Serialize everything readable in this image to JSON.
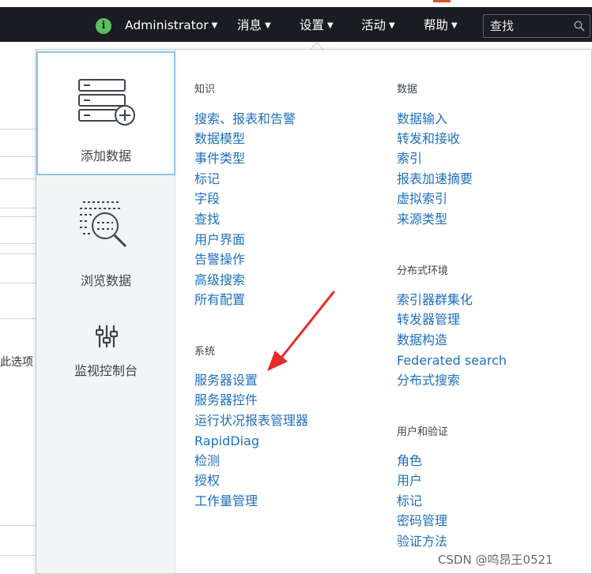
{
  "topbar": {
    "user_name": "Administrator",
    "menu_messages": "消息",
    "menu_settings": "设置",
    "menu_activity": "活动",
    "menu_help": "帮助",
    "search_placeholder": "查找"
  },
  "background": {
    "partial_text": "此选项"
  },
  "dropdown": {
    "tiles": [
      {
        "label": "添加数据",
        "icon": "add-data-icon"
      },
      {
        "label": "浏览数据",
        "icon": "explore-data-icon"
      },
      {
        "label": "监视控制台",
        "icon": "monitoring-console-icon"
      }
    ],
    "knowledge": {
      "title": "知识",
      "items": [
        "搜索、报表和告警",
        "数据模型",
        "事件类型",
        "标记",
        "字段",
        "查找",
        "用户界面",
        "告警操作",
        "高级搜索",
        "所有配置"
      ]
    },
    "system": {
      "title": "系统",
      "items": [
        "服务器设置",
        "服务器控件",
        "运行状况报表管理器",
        "RapidDiag",
        "检测",
        "授权",
        "工作量管理"
      ]
    },
    "data": {
      "title": "数据",
      "items": [
        "数据输入",
        "转发和接收",
        "索引",
        "报表加速摘要",
        "虚拟索引",
        "来源类型"
      ]
    },
    "distributed": {
      "title": "分布式环境",
      "items": [
        "索引器群集化",
        "转发器管理",
        "数据构造",
        "Federated search",
        "分布式搜索"
      ]
    },
    "users_auth": {
      "title": "用户和验证",
      "items": [
        "角色",
        "用户",
        "标记",
        "密码管理",
        "验证方法"
      ]
    }
  },
  "watermark": "CSDN @呜昂王0521"
}
